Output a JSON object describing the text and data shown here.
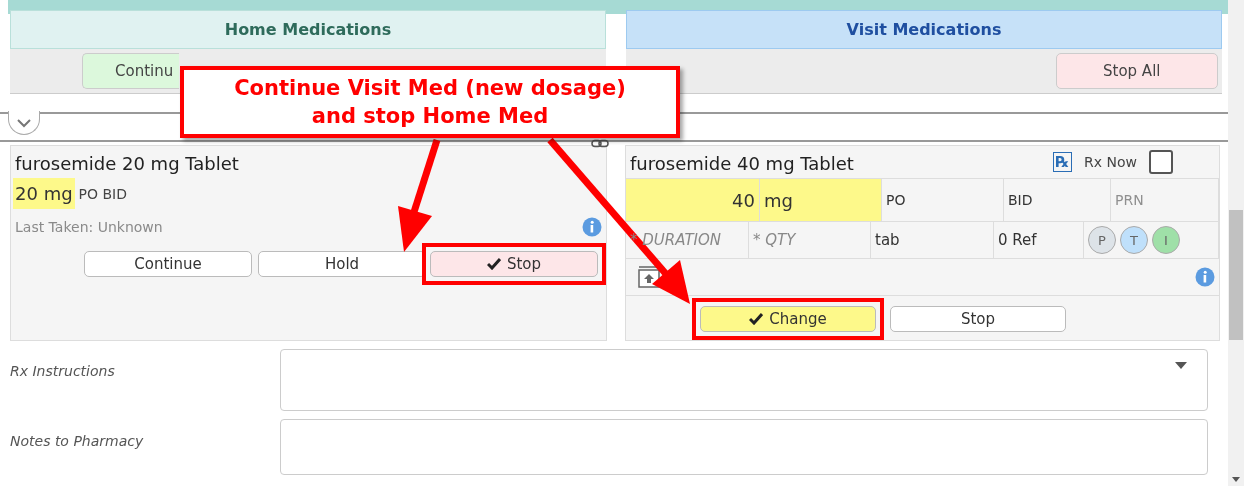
{
  "home_medications": {
    "title": "Home Medications",
    "toolbar_buttons": [
      {
        "label": "Continu",
        "kind": "continue"
      }
    ],
    "medication": {
      "name": "furosemide 20 mg Tablet",
      "dose": "20 mg",
      "route_frequency": "PO BID",
      "last_taken": "Last Taken: Unknown",
      "buttons": [
        {
          "label": "Continue",
          "kind": "continue",
          "checked": false,
          "highlighted": false
        },
        {
          "label": "Hold",
          "kind": "hold",
          "checked": false,
          "highlighted": false
        },
        {
          "label": "Stop",
          "kind": "stop",
          "checked": true,
          "highlighted": true
        }
      ]
    }
  },
  "visit_medications": {
    "title": "Visit Medications",
    "toolbar_buttons": [
      {
        "label": "Stop All",
        "kind": "stop"
      }
    ],
    "medication": {
      "name": "furosemide 40 mg Tablet",
      "rx_icon": "℞",
      "rx_now": {
        "label": "Rx Now",
        "checked": false
      },
      "dose_fields": [
        {
          "text": "40",
          "kind": "amount",
          "highlighted": true,
          "disabled": false
        },
        {
          "text": "mg",
          "kind": "value",
          "highlighted": true,
          "disabled": false
        },
        {
          "text": "PO",
          "kind": "value",
          "highlighted": false,
          "disabled": false
        },
        {
          "text": "BID",
          "kind": "value",
          "highlighted": false,
          "disabled": false
        },
        {
          "text": "PRN",
          "kind": "value",
          "highlighted": false,
          "disabled": true
        }
      ],
      "supply_fields": [
        {
          "text": "* DURATION",
          "kind": "placeholder"
        },
        {
          "text": "* QTY",
          "kind": "placeholder"
        },
        {
          "text": "tab",
          "kind": "value"
        },
        {
          "text": "0 Ref",
          "kind": "value"
        }
      ],
      "badges": [
        {
          "text": "P",
          "color": "#dde3e8"
        },
        {
          "text": "T",
          "color": "#bfe0fb"
        },
        {
          "text": "I",
          "color": "#9fe0a8"
        }
      ],
      "buttons": [
        {
          "label": "Change",
          "kind": "change",
          "checked": true,
          "highlighted": true
        },
        {
          "label": "Stop",
          "kind": "stop",
          "checked": false,
          "highlighted": false
        }
      ]
    }
  },
  "form_fields": [
    {
      "label": "Rx Instructions",
      "kind": "select"
    },
    {
      "label": "Notes to Pharmacy",
      "kind": "text"
    }
  ],
  "annotation": {
    "text": "Continue Visit Med (new dosage) and stop Home Med"
  }
}
